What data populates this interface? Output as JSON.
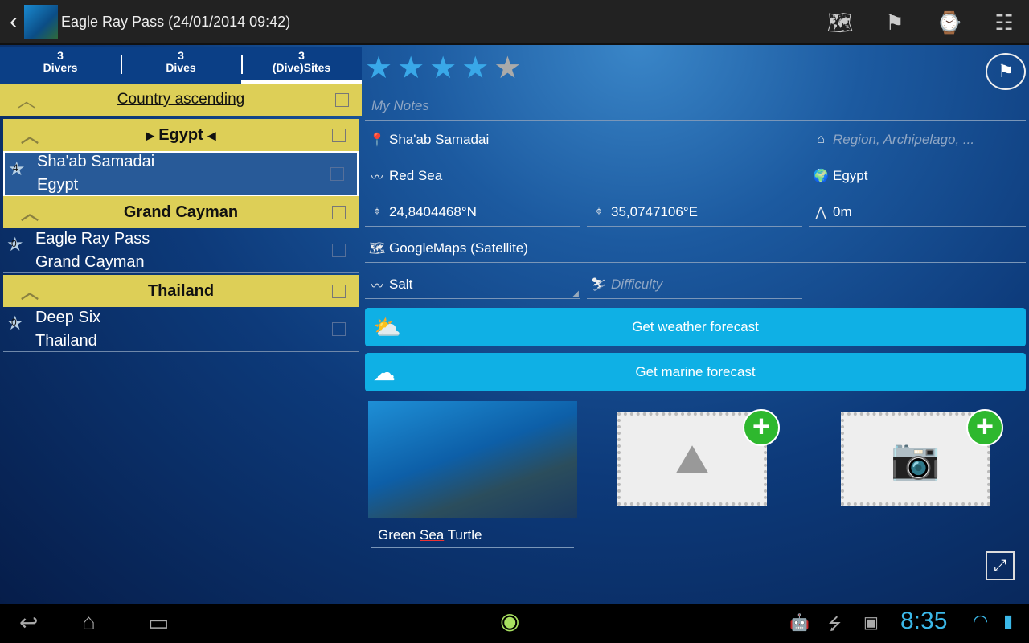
{
  "header": {
    "title": "Eagle Ray Pass (24/01/2014 09:42)",
    "icons": [
      "back-icon",
      "map-search-icon",
      "add-site-flag-icon",
      "dive-computer-icon",
      "settings-icon"
    ]
  },
  "tabs": [
    {
      "count": "3",
      "label": "Divers"
    },
    {
      "count": "3",
      "label": "Dives"
    },
    {
      "count": "3",
      "label": "(Dive)Sites"
    }
  ],
  "sort": {
    "label": "Country ascending"
  },
  "groups": [
    {
      "name": "Egypt",
      "items": [
        {
          "rating": "4",
          "name": "Sha'ab Samadai",
          "country": "Egypt"
        }
      ]
    },
    {
      "name": "Grand Cayman",
      "items": [
        {
          "rating": "0",
          "name": "Eagle Ray Pass",
          "country": "Grand Cayman"
        }
      ]
    },
    {
      "name": "Thailand",
      "items": [
        {
          "rating": "0",
          "name": "Deep Six",
          "country": "Thailand"
        }
      ]
    }
  ],
  "detail": {
    "rating": 4,
    "rating_max": 5,
    "notes_placeholder": "My Notes",
    "site": "Sha'ab Samadai",
    "region_placeholder": "Region, Archipelago, ...",
    "water": "Red Sea",
    "country": "Egypt",
    "lat": "24,8404468°N",
    "lon": "35,0747106°E",
    "altitude": "0m",
    "map": "GoogleMaps (Satellite)",
    "water_type": "Salt",
    "difficulty_placeholder": "Difficulty",
    "weather_btn": "Get weather forecast",
    "marine_btn": "Get marine forecast",
    "photo_caption_pre": "Green ",
    "photo_caption_mid": "Sea",
    "photo_caption_post": " Turtle"
  },
  "status": {
    "time": "8:35"
  }
}
